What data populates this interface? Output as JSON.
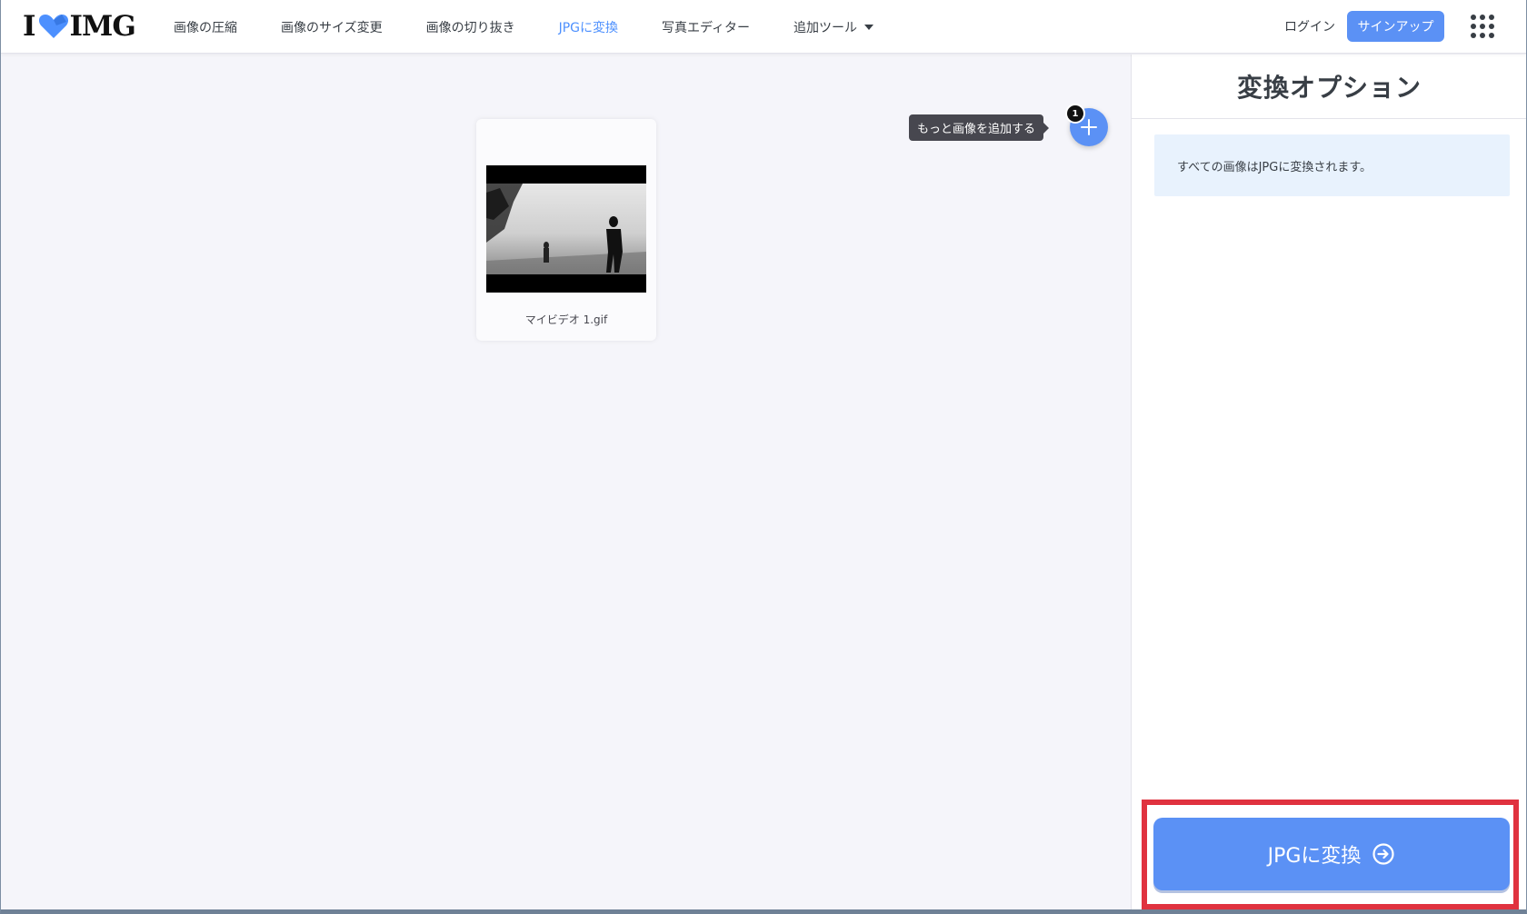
{
  "header": {
    "logo_left": "I",
    "logo_right": "IMG",
    "nav": [
      {
        "label": "画像の圧縮"
      },
      {
        "label": "画像のサイズ変更"
      },
      {
        "label": "画像の切り抜き"
      },
      {
        "label": "JPGに変換",
        "active": true
      },
      {
        "label": "写真エディター"
      },
      {
        "label": "追加ツール"
      }
    ],
    "login_label": "ログイン",
    "signup_label": "サインアップ"
  },
  "workspace": {
    "file": {
      "name": "マイビデオ 1.gif"
    },
    "add_tooltip": "もっと画像を追加する",
    "file_count": "1"
  },
  "sidebar": {
    "title": "変換オプション",
    "info": "すべての画像はJPGに変換されます。",
    "convert_label": "JPGに変換"
  },
  "colors": {
    "accent": "#5b91f5",
    "highlight": "#e0323f",
    "info_bg": "#e8f2fd"
  },
  "icons": [
    "heart-logo-icon",
    "chevron-down-icon",
    "apps-grid-icon",
    "plus-icon",
    "arrow-right-circle-icon"
  ]
}
